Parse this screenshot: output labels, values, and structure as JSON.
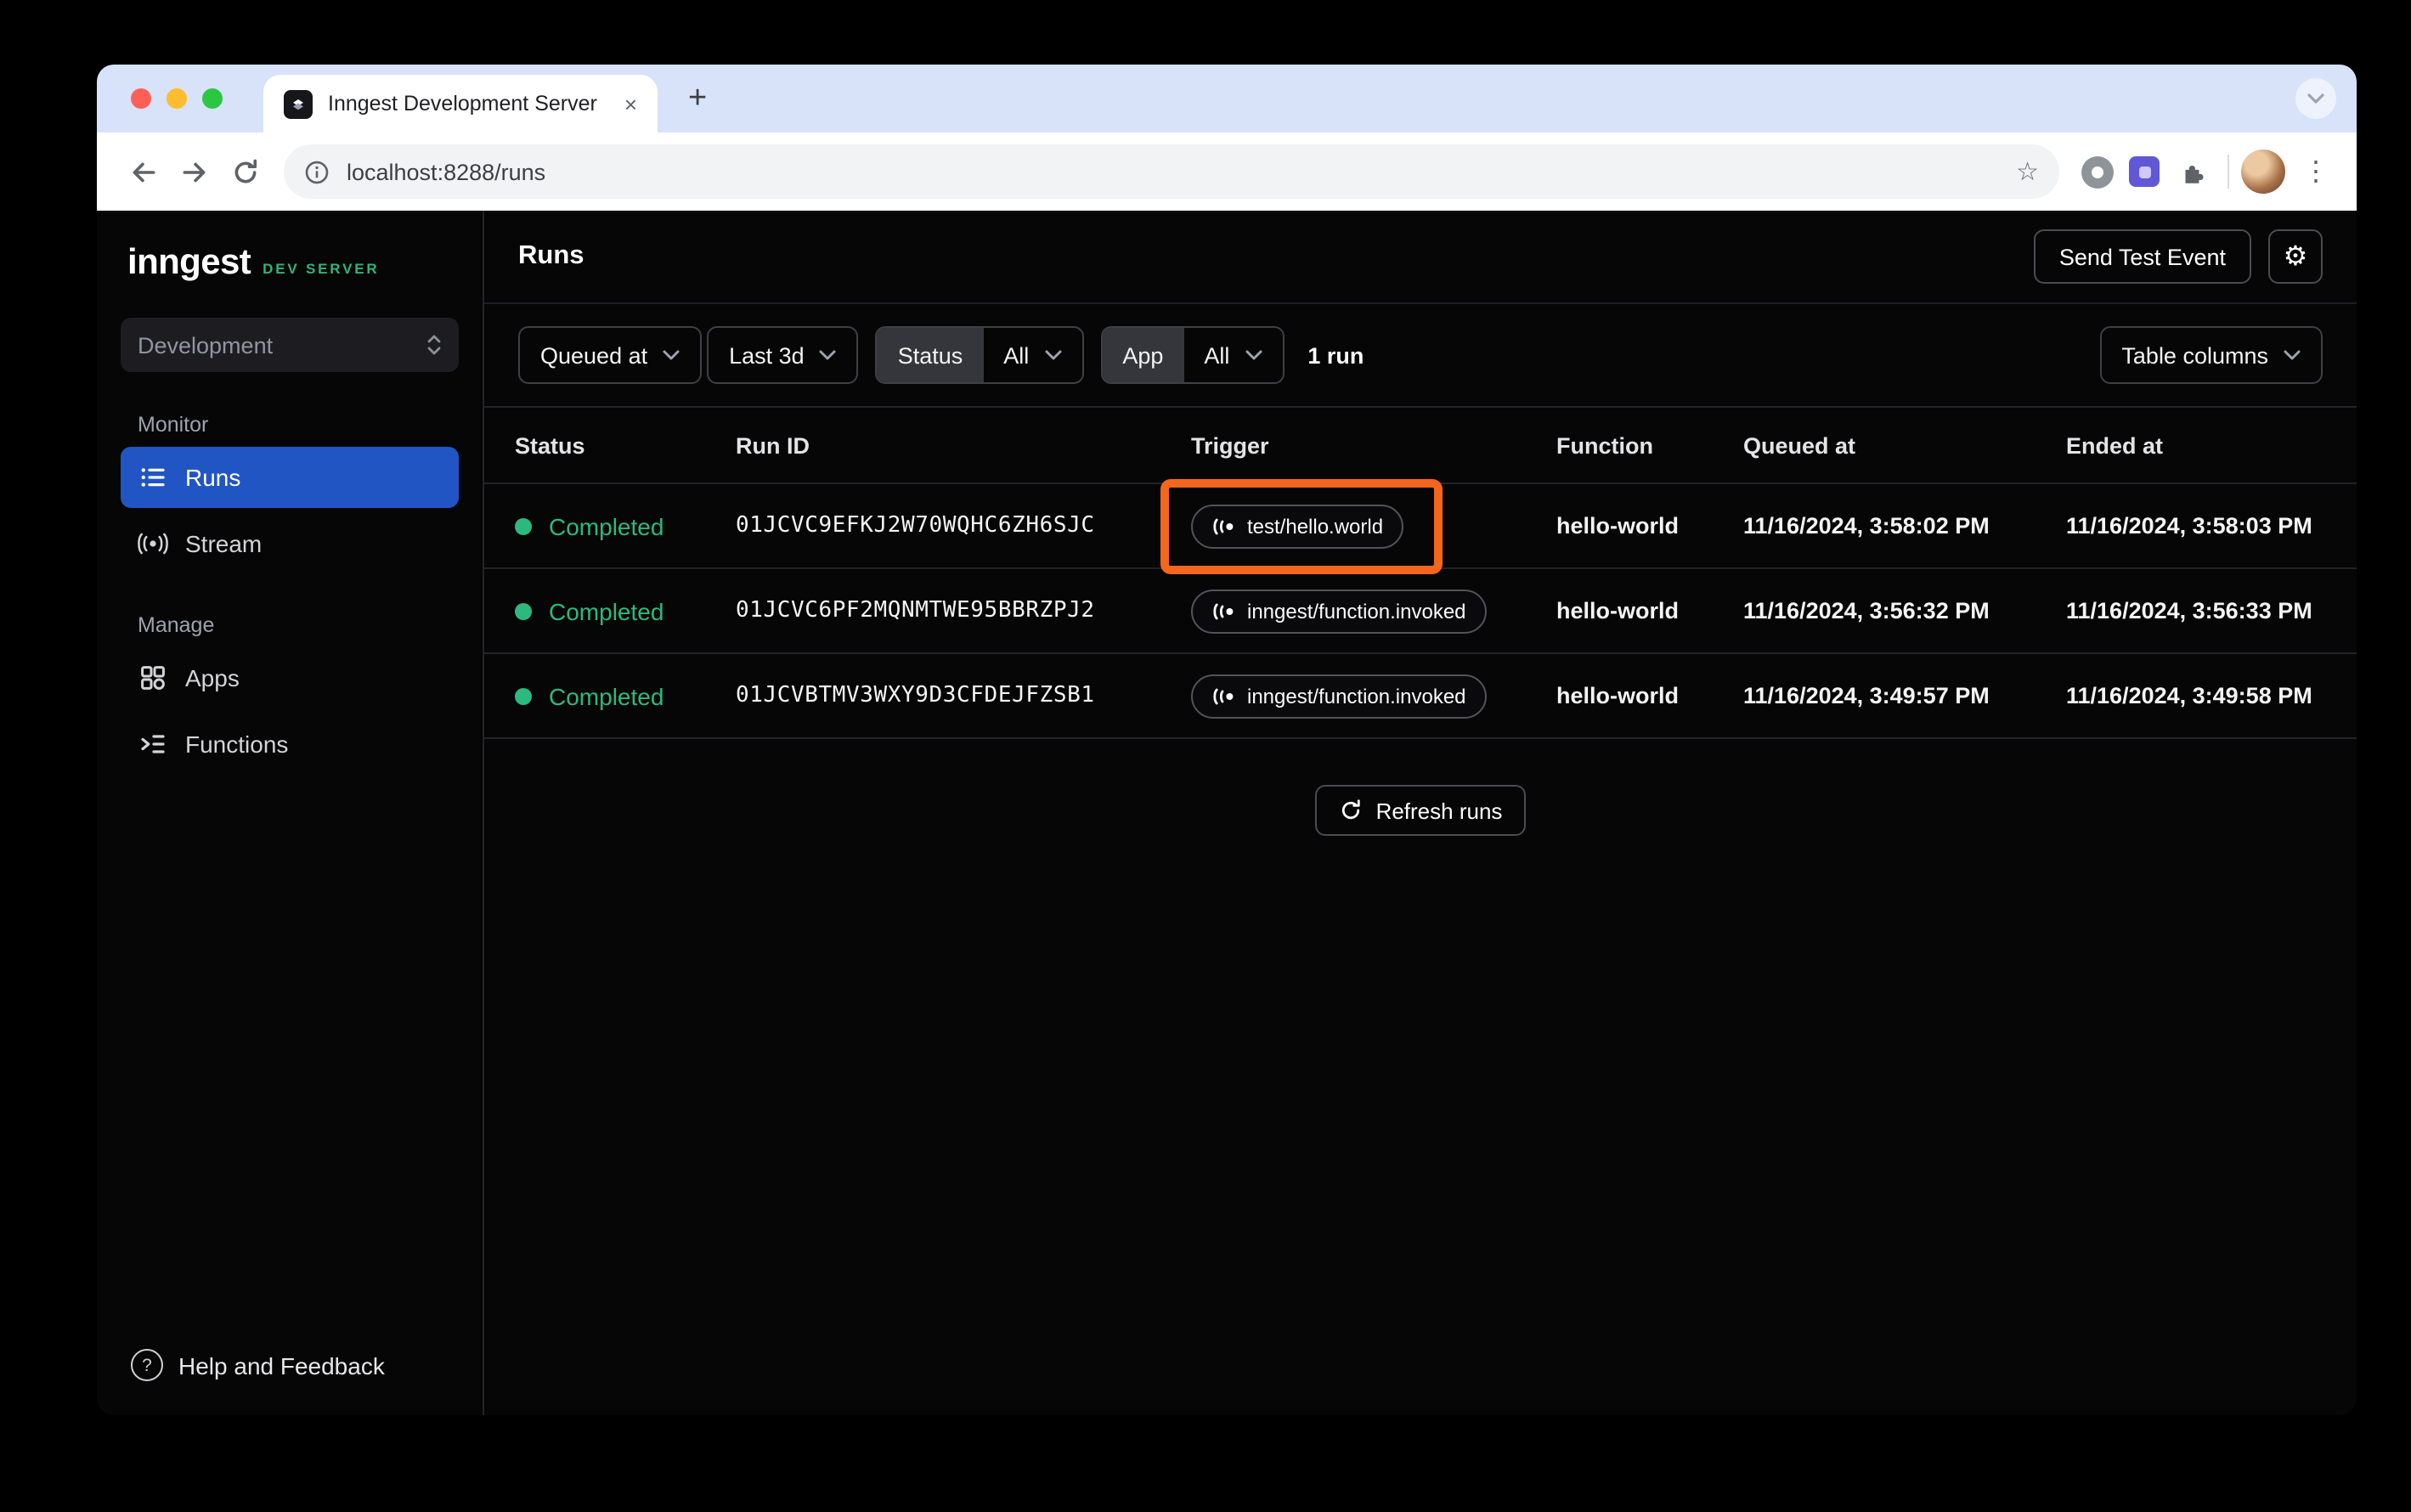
{
  "browser": {
    "tab_title": "Inngest Development Server",
    "url": "localhost:8288/runs"
  },
  "sidebar": {
    "logo": "inngest",
    "logo_badge": "DEV SERVER",
    "environment": "Development",
    "monitor_label": "Monitor",
    "manage_label": "Manage",
    "items": {
      "runs": "Runs",
      "stream": "Stream",
      "apps": "Apps",
      "functions": "Functions"
    },
    "help": "Help and Feedback"
  },
  "header": {
    "title": "Runs",
    "send_test_event": "Send Test Event",
    "settings_icon": "gear-icon"
  },
  "filters": {
    "field": "Queued at",
    "range": "Last 3d",
    "status_label": "Status",
    "status_value": "All",
    "app_label": "App",
    "app_value": "All",
    "count": "1 run",
    "table_columns": "Table columns"
  },
  "table": {
    "columns": [
      "Status",
      "Run ID",
      "Trigger",
      "Function",
      "Queued at",
      "Ended at"
    ],
    "rows": [
      {
        "status": "Completed",
        "run_id": "01JCVC9EFKJ2W70WQHC6ZH6SJC",
        "trigger": "test/hello.world",
        "function": "hello-world",
        "queued_at": "11/16/2024, 3:58:02 PM",
        "ended_at": "11/16/2024, 3:58:03 PM",
        "highlighted": true
      },
      {
        "status": "Completed",
        "run_id": "01JCVC6PF2MQNMTWE95BBRZPJ2",
        "trigger": "inngest/function.invoked",
        "function": "hello-world",
        "queued_at": "11/16/2024, 3:56:32 PM",
        "ended_at": "11/16/2024, 3:56:33 PM",
        "highlighted": false
      },
      {
        "status": "Completed",
        "run_id": "01JCVBTMV3WXY9D3CFDEJFZSB1",
        "trigger": "inngest/function.invoked",
        "function": "hello-world",
        "queued_at": "11/16/2024, 3:49:57 PM",
        "ended_at": "11/16/2024, 3:49:58 PM",
        "highlighted": false
      }
    ],
    "refresh_label": "Refresh runs"
  },
  "colors": {
    "sidebar_active_blue": "#2255c4",
    "status_green": "#2cb97f",
    "dev_badge_green": "#2fb47c",
    "annotation_orange": "#f3661c",
    "tabstrip_blue": "#d8e2f8",
    "app_background": "#060606"
  }
}
